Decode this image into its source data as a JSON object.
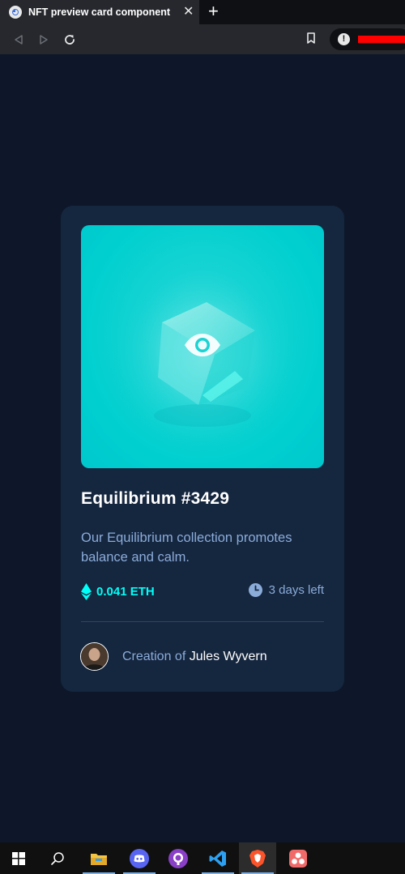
{
  "browser": {
    "tab_title": "NFT preview card component",
    "tab_close": "✕",
    "new_tab": "+",
    "url_warning": "!"
  },
  "card": {
    "title": "Equilibrium #3429",
    "description": "Our Equilibrium collection promotes balance and calm.",
    "price": "0.041 ETH",
    "time_left": "3 days left",
    "creation_prefix": "Creation of",
    "creator_name": "Jules Wyvern"
  },
  "colors": {
    "page_background": "#0d1729",
    "card_background": "#15263f",
    "accent_cyan": "#00fff8",
    "soft_blue": "#8bacd9",
    "white": "#ffffff"
  },
  "taskbar": {
    "items": [
      "windows-start-icon",
      "search-icon",
      "file-explorer-icon",
      "discord-icon",
      "github-icon",
      "vscode-icon",
      "brave-icon",
      "app-icon"
    ]
  }
}
